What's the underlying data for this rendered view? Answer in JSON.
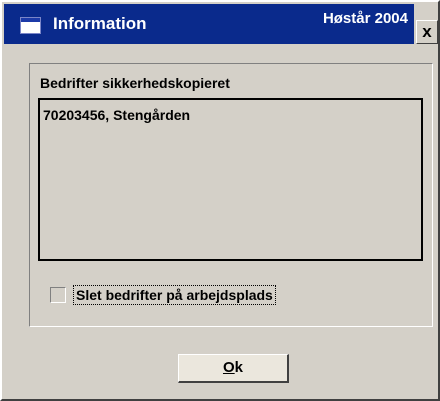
{
  "window": {
    "title": "Information",
    "title_right": "Høstår 2004",
    "close_label": "x"
  },
  "list": {
    "label": "Bedrifter sikkerhedskopieret",
    "items": [
      "70203456, Stengården"
    ]
  },
  "checkbox": {
    "label": "Slet bedrifter på arbejdsplads",
    "checked": false
  },
  "buttons": {
    "ok_mnemonic": "O",
    "ok_rest": "k"
  },
  "colors": {
    "titlebar": "#0a2a8c",
    "face": "#d4d0c8"
  }
}
